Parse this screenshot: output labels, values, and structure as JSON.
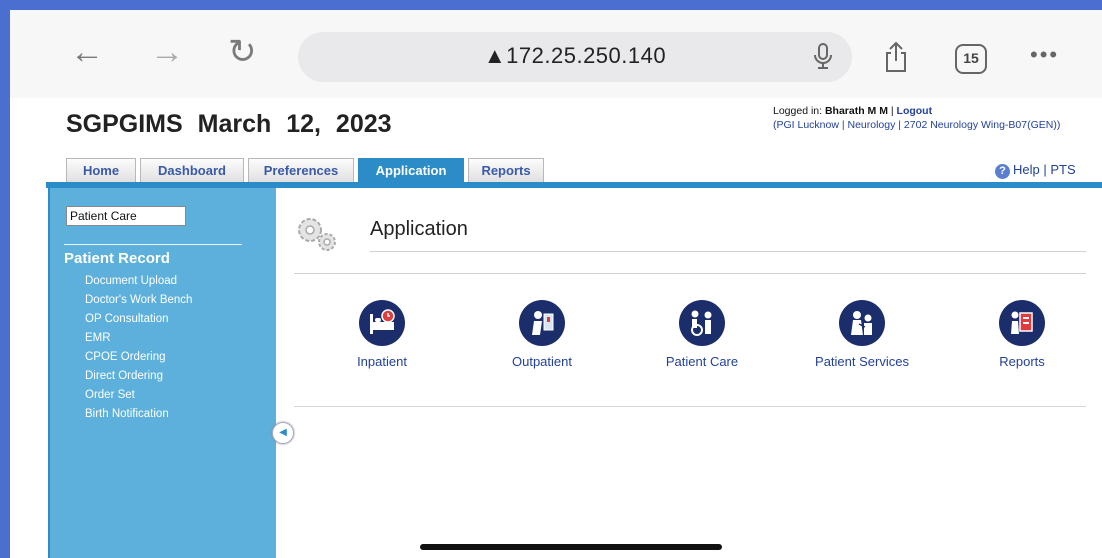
{
  "browser": {
    "back_icon": "back-arrow-icon",
    "forward_icon": "forward-arrow-icon",
    "reload_icon": "reload-icon",
    "url": "▲172.25.250.140",
    "tab_count": "15",
    "more": "•••"
  },
  "header": {
    "site": "SGPGIMS",
    "date": "March 12, 2023",
    "logged_in_prefix": "Logged in: ",
    "user": "Bharath M M",
    "sep": " | ",
    "logout": "Logout",
    "location": "(PGI Lucknow | Neurology | 2702 Neurology Wing-B07(GEN))",
    "help_label": "Help",
    "help_sep": "|",
    "pts_label": "PTS"
  },
  "tabs": [
    {
      "label": "Home"
    },
    {
      "label": "Dashboard"
    },
    {
      "label": "Preferences"
    },
    {
      "label": "Application"
    },
    {
      "label": "Reports"
    }
  ],
  "sidebar": {
    "select_value": "Patient Care",
    "heading": "Patient Record",
    "items": [
      {
        "label": "Document Upload"
      },
      {
        "label": "Doctor's Work Bench"
      },
      {
        "label": "OP Consultation"
      },
      {
        "label": "EMR"
      },
      {
        "label": "CPOE Ordering"
      },
      {
        "label": "Direct Ordering"
      },
      {
        "label": "Order Set"
      },
      {
        "label": "Birth Notification"
      }
    ]
  },
  "main": {
    "title": "Application",
    "modules": [
      {
        "label": "Inpatient",
        "icon": "hospital-bed-icon"
      },
      {
        "label": "Outpatient",
        "icon": "doctor-consult-icon"
      },
      {
        "label": "Patient Care",
        "icon": "wheelchair-icon"
      },
      {
        "label": "Patient Services",
        "icon": "doctor-patient-icon"
      },
      {
        "label": "Reports",
        "icon": "report-person-icon"
      }
    ]
  },
  "colors": {
    "accent": "#2b8cc8",
    "sidebar": "#5db0db",
    "icon_bg": "#1b2d6b",
    "link": "#23419a"
  }
}
